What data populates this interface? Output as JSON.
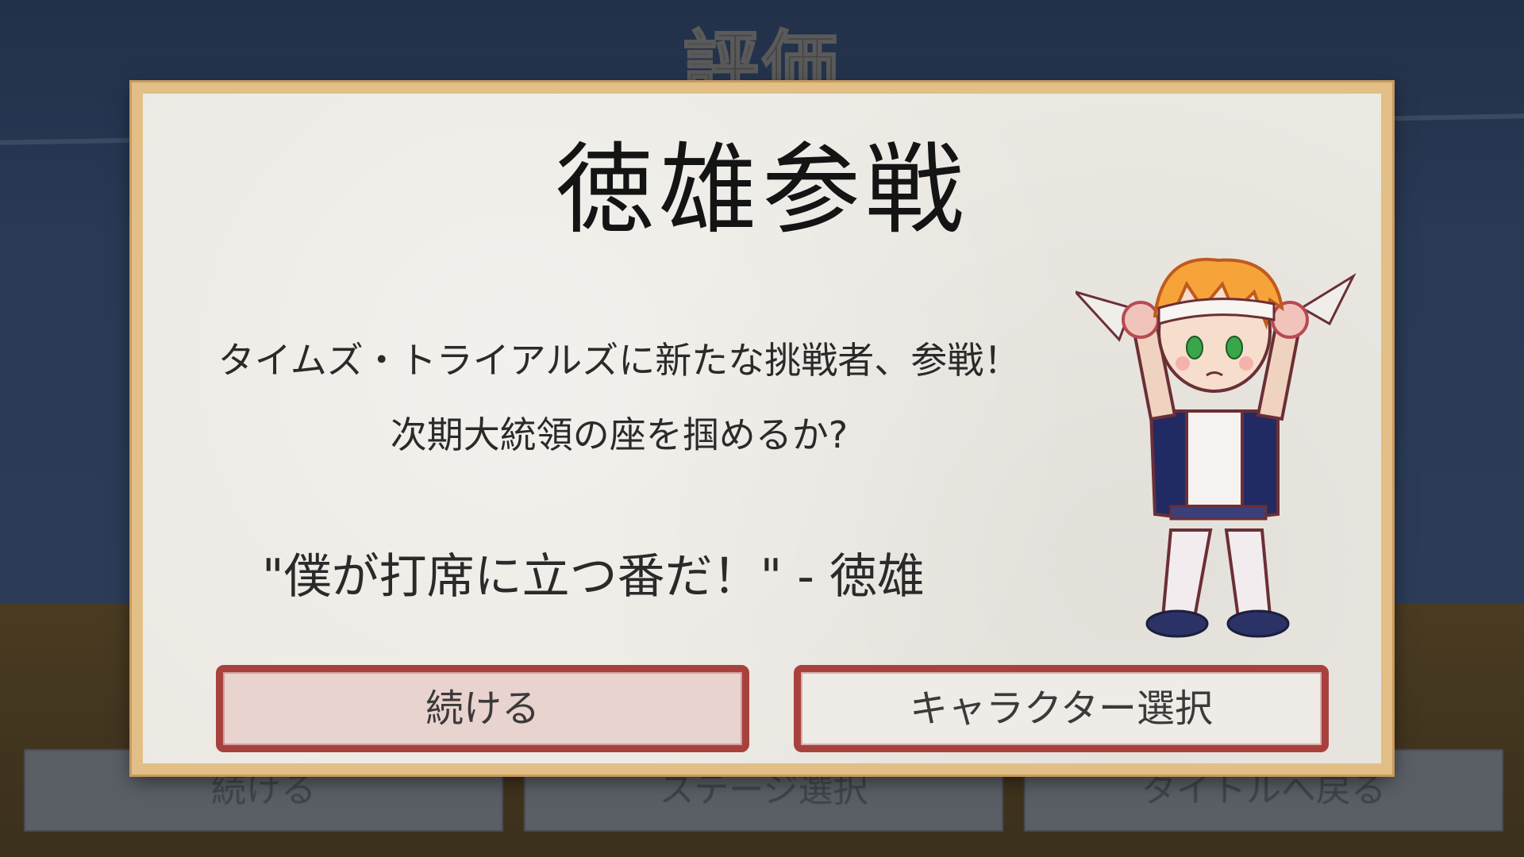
{
  "background": {
    "title": "評価",
    "buttons": [
      "続ける",
      "ステージ選択",
      "タイトルへ戻る"
    ]
  },
  "dialog": {
    "title": "徳雄参戦",
    "message_line1": "タイムズ・トライアルズに新たな挑戦者、参戦！",
    "message_line2": "次期大統領の座を掴めるか?",
    "quote": "\"僕が打席に立つ番だ！\" - 徳雄",
    "continue_label": "続ける",
    "character_select_label": "キャラクター選択",
    "character_icon": "chibi-character-norio"
  },
  "colors": {
    "frame": "#e2bf86",
    "paper": "#ece9e3",
    "button_border": "#a8413d",
    "background": "#223049",
    "floor": "#4a3b22"
  }
}
